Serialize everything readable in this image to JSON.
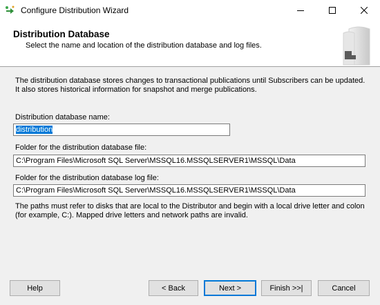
{
  "window": {
    "title": "Configure Distribution Wizard"
  },
  "header": {
    "title": "Distribution Database",
    "subtitle": "Select the name and location of the distribution database and log files."
  },
  "description": "The distribution database stores changes to transactional publications until Subscribers can be updated. It also stores historical information for snapshot and merge publications.",
  "fields": {
    "db_name_label": "Distribution database name:",
    "db_name_value": "distribution",
    "db_folder_label": "Folder for the distribution database file:",
    "db_folder_value": "C:\\Program Files\\Microsoft SQL Server\\MSSQL16.MSSQLSERVER1\\MSSQL\\Data",
    "log_folder_label": "Folder for the distribution database log file:",
    "log_folder_value": "C:\\Program Files\\Microsoft SQL Server\\MSSQL16.MSSQLSERVER1\\MSSQL\\Data"
  },
  "note": "The paths must refer to disks that are local to the Distributor and begin with a local drive letter and colon (for example, C:). Mapped drive letters and network paths are invalid.",
  "buttons": {
    "help": "Help",
    "back": "< Back",
    "next": "Next >",
    "finish": "Finish >>|",
    "cancel": "Cancel"
  }
}
